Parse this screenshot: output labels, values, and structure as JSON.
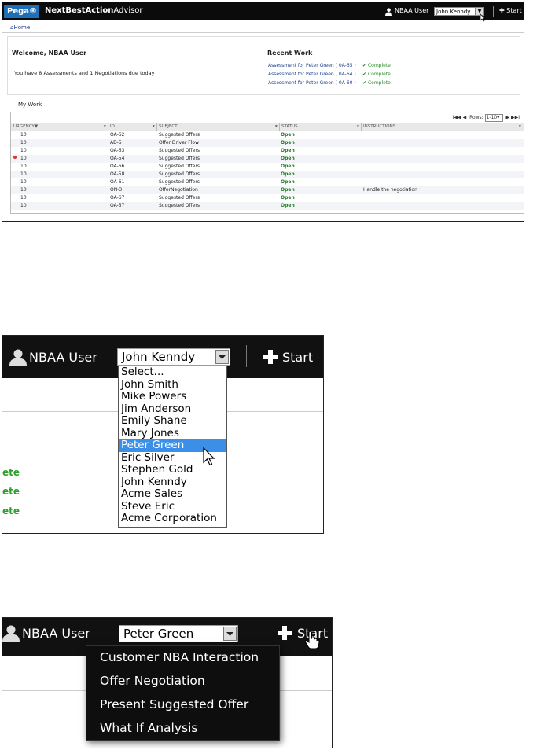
{
  "panel1": {
    "logo": "Pega® 7",
    "app_title_bold": "NextBestAction",
    "app_title_thin": "Advisor",
    "user_label": "NBAA User",
    "selected_customer": "John Kenndy",
    "start_label": "Start",
    "breadcrumb_home": "Home",
    "welcome_title": "Welcome, NBAA User",
    "welcome_message": "You have 8 Assessments and 1 Negotiations due today",
    "recent_work_title": "Recent Work",
    "recent_work": [
      {
        "label": "Assessment for Peter Green ( 0A-65 )",
        "status": "Complete"
      },
      {
        "label": "Assessment for Peter Green ( 0A-64 )",
        "status": "Complete"
      },
      {
        "label": "Assessment for Peter Green ( 0A-60 )",
        "status": "Complete"
      }
    ],
    "my_work_label": "My Work",
    "pager": {
      "rows_label": "Rows:",
      "rows_value": "1-10",
      "first": "I◀◀",
      "prev": "◀",
      "next": "▶",
      "last": "▶▶I"
    },
    "columns": [
      "URGENCY",
      "ID",
      "SUBJECT",
      "STATUS",
      "INSTRUCTIONS"
    ],
    "rows": [
      {
        "urgency": "10",
        "id": "OA-62",
        "subject": "Suggested Offers",
        "status": "Open",
        "instructions": ""
      },
      {
        "urgency": "10",
        "id": "AD-5",
        "subject": "Offer Driver Flow",
        "status": "Open",
        "instructions": ""
      },
      {
        "urgency": "10",
        "id": "OA-63",
        "subject": "Suggested Offers",
        "status": "Open",
        "instructions": ""
      },
      {
        "urgency": "10",
        "id": "OA-54",
        "subject": "Suggested Offers",
        "status": "Open",
        "instructions": ""
      },
      {
        "urgency": "10",
        "id": "OA-66",
        "subject": "Suggested Offers",
        "status": "Open",
        "instructions": ""
      },
      {
        "urgency": "10",
        "id": "OA-58",
        "subject": "Suggested Offers",
        "status": "Open",
        "instructions": ""
      },
      {
        "urgency": "10",
        "id": "OA-61",
        "subject": "Suggested Offers",
        "status": "Open",
        "instructions": ""
      },
      {
        "urgency": "10",
        "id": "ON-3",
        "subject": "OfferNegotiation",
        "status": "Open",
        "instructions": "Handle the negotiation"
      },
      {
        "urgency": "10",
        "id": "OA-67",
        "subject": "Suggested Offers",
        "status": "Open",
        "instructions": ""
      },
      {
        "urgency": "10",
        "id": "OA-57",
        "subject": "Suggested Offers",
        "status": "Open",
        "instructions": ""
      }
    ]
  },
  "panel2": {
    "user_label": "NBAA User",
    "selected_customer": "John Kenndy",
    "start_label": "Start",
    "options": [
      "Select...",
      "John Smith",
      "Mike Powers",
      "Jim Anderson",
      "Emily Shane",
      "Mary Jones",
      "Peter Green",
      "Eric Silver",
      "Stephen Gold",
      "John Kenndy",
      "Acme Sales",
      "Steve Eric",
      "Acme Corporation"
    ],
    "highlighted_option": "Peter Green",
    "status_fragments": [
      "ete",
      "ete",
      "ete"
    ]
  },
  "panel3": {
    "user_label": "NBAA User",
    "selected_customer": "Peter Green",
    "start_label": "Start",
    "start_menu": [
      "Customer NBA Interaction",
      "Offer Negotiation",
      "Present Suggested Offer",
      "What If Analysis"
    ]
  },
  "colors": {
    "topbar": "#0b0b0b",
    "link": "#1a3e8a",
    "complete": "#2a8a2a",
    "open": "#1e7a1e",
    "highlight": "#3b8fe6",
    "logo": "#1e6fb8"
  }
}
